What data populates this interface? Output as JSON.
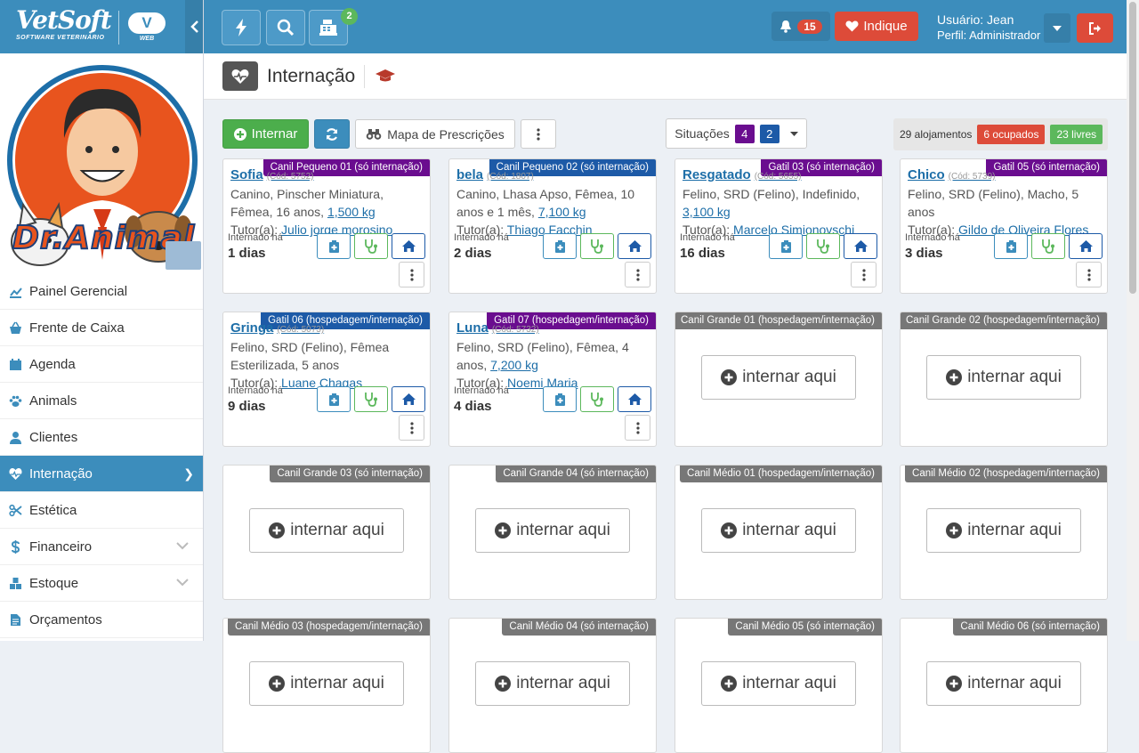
{
  "app": {
    "brand_name": "VetSoft",
    "brand_tagline": "SOFTWARE VETERINÁRIO",
    "cloud_label": "V",
    "cloud_sub": "WEB"
  },
  "clinic": {
    "logo_text": "Dr.Animal"
  },
  "sidebar": {
    "items": [
      {
        "label": "Painel Gerencial",
        "icon": "chart-icon"
      },
      {
        "label": "Frente de Caixa",
        "icon": "basket-icon"
      },
      {
        "label": "Agenda",
        "icon": "calendar-icon"
      },
      {
        "label": "Animals",
        "icon": "paw-icon"
      },
      {
        "label": "Clientes",
        "icon": "user-icon"
      },
      {
        "label": "Internação",
        "icon": "heartbeat-icon",
        "active": true
      },
      {
        "label": "Estética",
        "icon": "scissors-icon"
      },
      {
        "label": "Financeiro",
        "icon": "dollar-icon"
      },
      {
        "label": "Estoque",
        "icon": "boxes-icon"
      },
      {
        "label": "Orçamentos",
        "icon": "file-icon"
      }
    ]
  },
  "topbar": {
    "cash_badge": "2",
    "notifications_count": "15",
    "indique_label": "Indique",
    "user_label": "Usuário: Jean",
    "profile_label": "Perfil: Administrador"
  },
  "page": {
    "title": "Internação"
  },
  "toolbar": {
    "internar_label": "Internar",
    "mapa_label": "Mapa de Prescrições",
    "situacoes_label": "Situações",
    "situacoes_count_1": "4",
    "situacoes_count_2": "2",
    "alojamentos_label": "29 alojamentos",
    "ocupados_label": "6 ocupados",
    "livres_label": "23 livres"
  },
  "labels": {
    "internado_ha": "Internado há",
    "internar_aqui": "internar aqui",
    "tutor_prefix": "Tutor(a):"
  },
  "colors": {
    "primary": "#3c8dbc",
    "success": "#5cb85c",
    "danger": "#dd4b39",
    "tag_purple": "#6a0d8f",
    "tag_blue": "#1d5aa7"
  },
  "cards": [
    {
      "tag": "Canil Pequeno 01 (só internação)",
      "tag_color": "purple",
      "name": "Sofia",
      "cod": "(Cód: 5752)",
      "desc": "Canino, Pinscher Miniatura, Fêmea, 16 anos,",
      "weight": "1,500 kg",
      "tutor": "Julio jorge morosino",
      "days": "1 dias"
    },
    {
      "tag": "Canil Pequeno 02 (só internação)",
      "tag_color": "blue",
      "name": "bela",
      "cod": "(Cód: 1807)",
      "desc": "Canino, Lhasa Apso, Fêmea, 10 anos e 1 mês,",
      "weight": "7,100 kg",
      "tutor": "Thiago Facchin",
      "days": "2 dias"
    },
    {
      "tag": "Gatil 03 (só internação)",
      "tag_color": "purple",
      "name": "Resgatado",
      "cod": "(Cód: 5655)",
      "desc": "Felino, SRD (Felino), Indefinido,",
      "weight": "3,100 kg",
      "tutor": "Marcelo Simionovschi",
      "days": "16 dias"
    },
    {
      "tag": "Gatil 05 (só internação)",
      "tag_color": "purple",
      "name": "Chico",
      "cod": "(Cód: 5739)",
      "desc": "Felino, SRD (Felino), Macho, 5 anos",
      "weight": "",
      "tutor": "Gildo de Oliveira Flores",
      "days": "3 dias"
    },
    {
      "tag": "Gatil 06 (hospedagem/internação)",
      "tag_color": "blue",
      "name": "Gringa",
      "cod": "(Cód: 5073)",
      "desc": "Felino, SRD (Felino), Fêmea Esterilizada, 5 anos",
      "weight": "",
      "tutor": "Luane Chagas",
      "days": "9 dias"
    },
    {
      "tag": "Gatil 07 (hospedagem/internação)",
      "tag_color": "purple",
      "name": "Luna",
      "cod": "(Cód: 5732)",
      "desc": "Felino, SRD (Felino), Fêmea, 4 anos,",
      "weight": "7,200 kg",
      "tutor": "Noemi Maria",
      "days": "4 dias"
    },
    {
      "tag": "Canil Grande 01 (hospedagem/internação)",
      "tag_color": "gray",
      "empty": true
    },
    {
      "tag": "Canil Grande 02 (hospedagem/internação)",
      "tag_color": "gray",
      "empty": true
    },
    {
      "tag": "Canil Grande 03 (só internação)",
      "tag_color": "gray",
      "empty": true
    },
    {
      "tag": "Canil Grande 04 (só internação)",
      "tag_color": "gray",
      "empty": true
    },
    {
      "tag": "Canil Médio 01 (hospedagem/internação)",
      "tag_color": "gray",
      "empty": true
    },
    {
      "tag": "Canil Médio 02 (hospedagem/internação)",
      "tag_color": "gray",
      "empty": true
    },
    {
      "tag": "Canil Médio 03 (hospedagem/internação)",
      "tag_color": "gray",
      "empty": true
    },
    {
      "tag": "Canil Médio 04 (só internação)",
      "tag_color": "gray",
      "empty": true
    },
    {
      "tag": "Canil Médio 05 (só internação)",
      "tag_color": "gray",
      "empty": true
    },
    {
      "tag": "Canil Médio 06 (só internação)",
      "tag_color": "gray",
      "empty": true
    }
  ]
}
